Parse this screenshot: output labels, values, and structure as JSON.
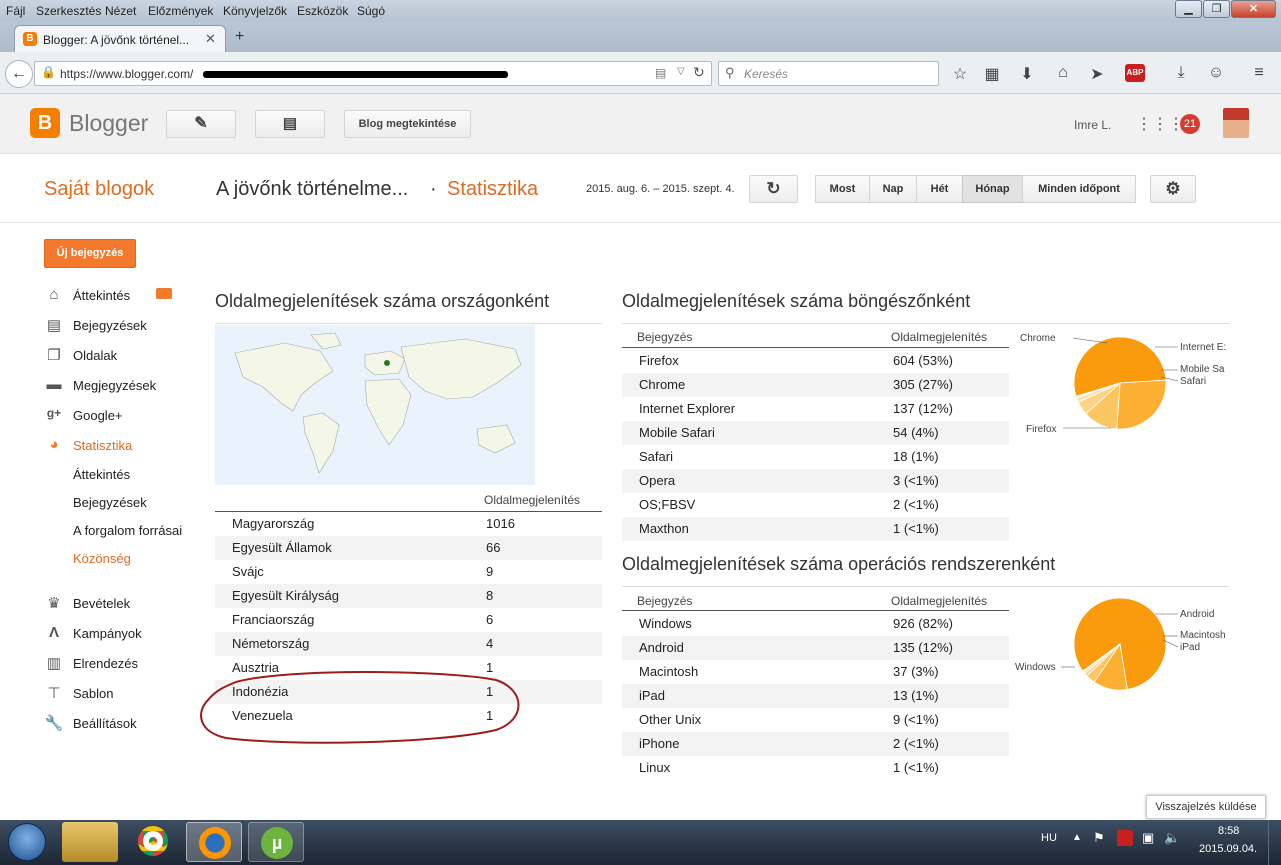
{
  "menu": [
    "Fájl",
    "Szerkesztés",
    "Nézet",
    "Előzmények",
    "Könyvjelzők",
    "Eszközök",
    "Súgó"
  ],
  "browser": {
    "tab_title": "Blogger: A jövőnk történel...",
    "url": "https://www.blogger.com/",
    "search_placeholder": "Keresés"
  },
  "blogger": {
    "logo": "Blogger",
    "view_blog": "Blog megtekintése",
    "user": "Imre L.",
    "notifications": "21"
  },
  "titlebar": {
    "my_blogs": "Saját blogok",
    "blog_title": "A jövőnk történelme...",
    "separator": "·",
    "section": "Statisztika",
    "date_range": "2015. aug. 6. – 2015. szept. 4.",
    "periods": [
      "Most",
      "Nap",
      "Hét",
      "Hónap",
      "Minden időpont"
    ],
    "active_period": "Hónap"
  },
  "sidebar": {
    "new_post": "Új bejegyzés",
    "items": [
      "Áttekintés",
      "Bejegyzések",
      "Oldalak",
      "Megjegyzések",
      "Google+",
      "Statisztika"
    ],
    "sub_items": [
      "Áttekintés",
      "Bejegyzések",
      "A forgalom forrásai",
      "Közönség"
    ],
    "items2": [
      "Bevételek",
      "Kampányok",
      "Elrendezés",
      "Sablon",
      "Beállítások"
    ]
  },
  "countries": {
    "title": "Oldalmegjelenítések száma országonként",
    "col": "Oldalmegjelenítés",
    "rows": [
      [
        "Magyarország",
        "1016"
      ],
      [
        "Egyesült Államok",
        "66"
      ],
      [
        "Svájc",
        "9"
      ],
      [
        "Egyesült Királyság",
        "8"
      ],
      [
        "Franciaország",
        "6"
      ],
      [
        "Németország",
        "4"
      ],
      [
        "Ausztria",
        "1"
      ],
      [
        "Indonézia",
        "1"
      ],
      [
        "Venezuela",
        "1"
      ]
    ]
  },
  "browsers": {
    "title": "Oldalmegjelenítések száma böngészőnként",
    "col1": "Bejegyzés",
    "col2": "Oldalmegjelenítés",
    "rows": [
      [
        "Firefox",
        "604 (53%)"
      ],
      [
        "Chrome",
        "305 (27%)"
      ],
      [
        "Internet Explorer",
        "137 (12%)"
      ],
      [
        "Mobile Safari",
        "54 (4%)"
      ],
      [
        "Safari",
        "18 (1%)"
      ],
      [
        "Opera",
        "3 (<1%)"
      ],
      [
        "OS;FBSV",
        "2 (<1%)"
      ],
      [
        "Maxthon",
        "1 (<1%)"
      ]
    ],
    "pie_labels": [
      "Chrome",
      "Internet E:",
      "Mobile Sa",
      "Safari",
      "Firefox"
    ]
  },
  "os": {
    "title": "Oldalmegjelenítések száma operációs rendszerenként",
    "col1": "Bejegyzés",
    "col2": "Oldalmegjelenítés",
    "rows": [
      [
        "Windows",
        "926 (82%)"
      ],
      [
        "Android",
        "135 (12%)"
      ],
      [
        "Macintosh",
        "37 (3%)"
      ],
      [
        "iPad",
        "13 (1%)"
      ],
      [
        "Other Unix",
        "9 (<1%)"
      ],
      [
        "iPhone",
        "2 (<1%)"
      ],
      [
        "Linux",
        "1 (<1%)"
      ]
    ],
    "pie_labels": [
      "Android",
      "Macintosh",
      "iPad",
      "Windows"
    ]
  },
  "feedback": "Visszajelzés küldése",
  "tray": {
    "lang": "HU",
    "time": "8:58",
    "date": "2015.09.04."
  }
}
